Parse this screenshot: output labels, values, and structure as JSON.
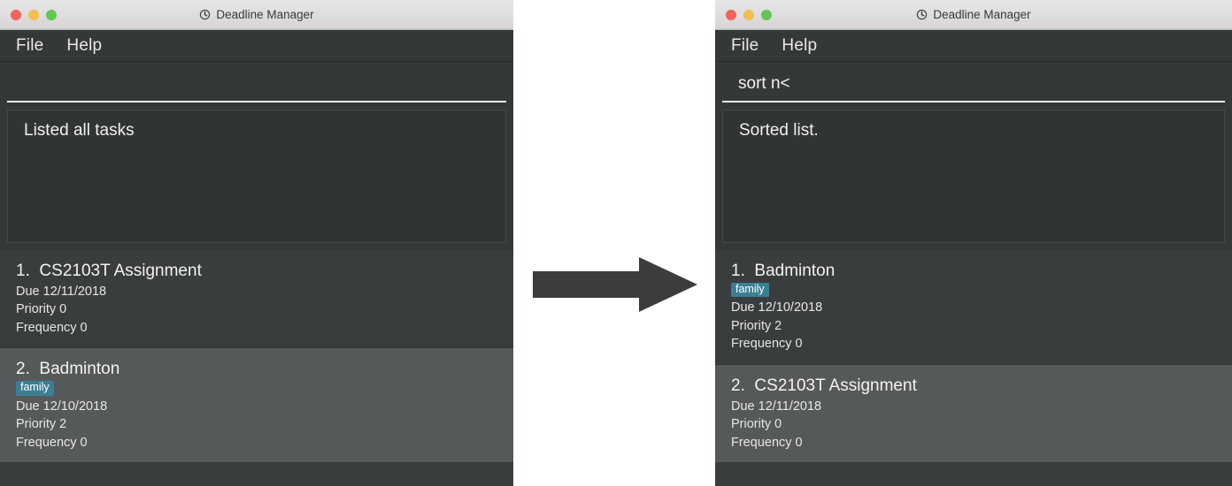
{
  "windows": [
    {
      "id": "before",
      "titlebar": {
        "title": "Deadline Manager",
        "icon": "clock-icon",
        "buttons": {
          "close": "close",
          "minimize": "minimize",
          "zoom": "zoom"
        }
      },
      "menubar": {
        "items": [
          "File",
          "Help"
        ]
      },
      "command": {
        "value": "",
        "placeholder": ""
      },
      "result": {
        "text": "Listed all tasks"
      },
      "tasks": [
        {
          "index": "1.",
          "name": "CS2103T Assignment",
          "tags": [],
          "due": "Due 12/11/2018",
          "priority": "Priority 0",
          "frequency": "Frequency 0",
          "selected": false
        },
        {
          "index": "2.",
          "name": "Badminton",
          "tags": [
            "family"
          ],
          "due": "Due 12/10/2018",
          "priority": "Priority 2",
          "frequency": "Frequency 0",
          "selected": true
        }
      ]
    },
    {
      "id": "after",
      "titlebar": {
        "title": "Deadline Manager",
        "icon": "clock-icon",
        "buttons": {
          "close": "close",
          "minimize": "minimize",
          "zoom": "zoom"
        }
      },
      "menubar": {
        "items": [
          "File",
          "Help"
        ]
      },
      "command": {
        "value": "sort n<",
        "placeholder": ""
      },
      "result": {
        "text": "Sorted list."
      },
      "tasks": [
        {
          "index": "1.",
          "name": "Badminton",
          "tags": [
            "family"
          ],
          "due": "Due 12/10/2018",
          "priority": "Priority 2",
          "frequency": "Frequency 0",
          "selected": false
        },
        {
          "index": "2.",
          "name": "CS2103T Assignment",
          "tags": [],
          "due": "Due 12/11/2018",
          "priority": "Priority 0",
          "frequency": "Frequency 0",
          "selected": true
        }
      ]
    }
  ],
  "arrow": {
    "icon": "right-arrow-icon",
    "color": "#3c3c3c"
  },
  "colors": {
    "window_bg": "#353839",
    "card_bg": "#3a3d3e",
    "card_selected_bg": "#56595a",
    "tag_bg": "#3a7f94",
    "text": "#f2f2f2",
    "titlebar_bg": "#e0dede"
  }
}
